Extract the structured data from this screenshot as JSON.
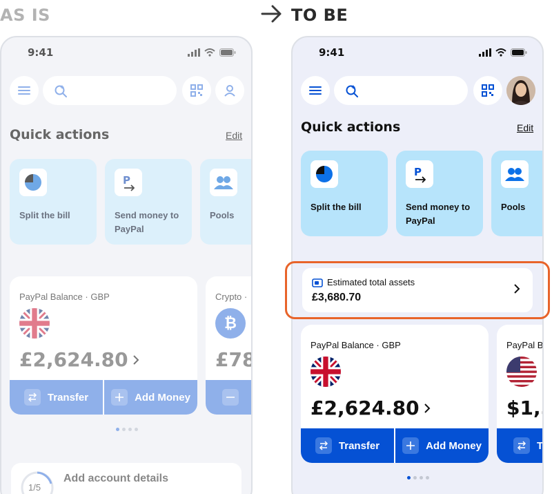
{
  "headings": {
    "as_is": "AS IS",
    "to_be": "TO BE"
  },
  "colors": {
    "accent": "#0551d4",
    "accent_faded": "#8fb0ea",
    "qa_card_bg": "#b7e4fb",
    "highlight": "#e8642a"
  },
  "as_is": {
    "status_time": "9:41",
    "quick_actions_title": "Quick actions",
    "edit_label": "Edit",
    "quick_actions": [
      {
        "label": "Split the bill",
        "icon": "pie-chart-icon"
      },
      {
        "label": "Send money to PayPal",
        "icon": "paypal-send-icon"
      },
      {
        "label": "Pools",
        "icon": "people-icon"
      }
    ],
    "balance_card": {
      "title": "PayPal Balance · GBP",
      "amount": "£2,624.80",
      "flag": "uk-flag",
      "transfer_label": "Transfer",
      "add_money_label": "Add Money"
    },
    "crypto_card": {
      "title": "Crypto ·",
      "amount": "£78",
      "icon": "bitcoin-icon"
    },
    "account_details": {
      "title": "Add account details",
      "progress_text": "1/5"
    }
  },
  "to_be": {
    "status_time": "9:41",
    "quick_actions_title": "Quick actions",
    "edit_label": "Edit",
    "quick_actions": [
      {
        "label": "Split the bill",
        "icon": "pie-chart-icon"
      },
      {
        "label": "Send money to PayPal",
        "icon": "paypal-send-icon"
      },
      {
        "label": "Pools",
        "icon": "people-icon"
      }
    ],
    "estimated_assets": {
      "label": "Estimated total assets",
      "value": "£3,680.70"
    },
    "balance_card": {
      "title": "PayPal Balance · GBP",
      "amount": "£2,624.80",
      "flag": "uk-flag",
      "transfer_label": "Transfer",
      "add_money_label": "Add Money"
    },
    "usd_card": {
      "title": "PayPal B",
      "amount": "$1,5",
      "flag": "us-flag",
      "transfer_label": "T"
    }
  }
}
